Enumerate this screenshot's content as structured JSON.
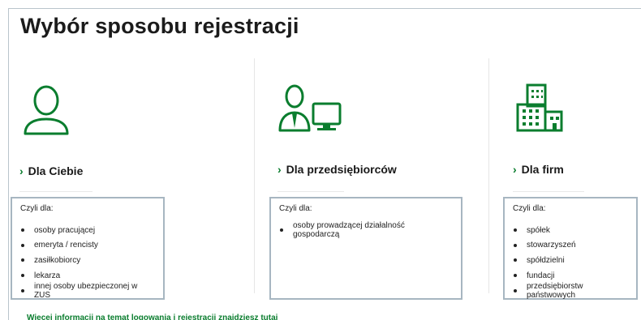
{
  "page": {
    "title": "Wybór sposobu rejestracji",
    "footer_link": "Więcej informacji na temat logowania i rejestracji znajdziesz tutaj"
  },
  "colors": {
    "accent": "#0a7d2e",
    "box_border": "#a7b6c1"
  },
  "options": [
    {
      "icon": "person-icon",
      "label": "Dla Ciebie",
      "box_heading": "Czyli dla:",
      "items": [
        "osoby pracującej",
        "emeryta / rencisty",
        "zasiłkobiorcy",
        "lekarza",
        "innej osoby ubezpieczonej w ZUS"
      ]
    },
    {
      "icon": "businessman-computer-icon",
      "label": "Dla przedsiębiorców",
      "box_heading": "Czyli dla:",
      "items": [
        "osoby prowadzącej działalność gospodarczą"
      ]
    },
    {
      "icon": "office-building-icon",
      "label": "Dla firm",
      "box_heading": "Czyli dla:",
      "items": [
        "spółek",
        "stowarzyszeń",
        "spółdzielni",
        "fundacji",
        "przedsiębiorstw państwowych"
      ]
    }
  ]
}
